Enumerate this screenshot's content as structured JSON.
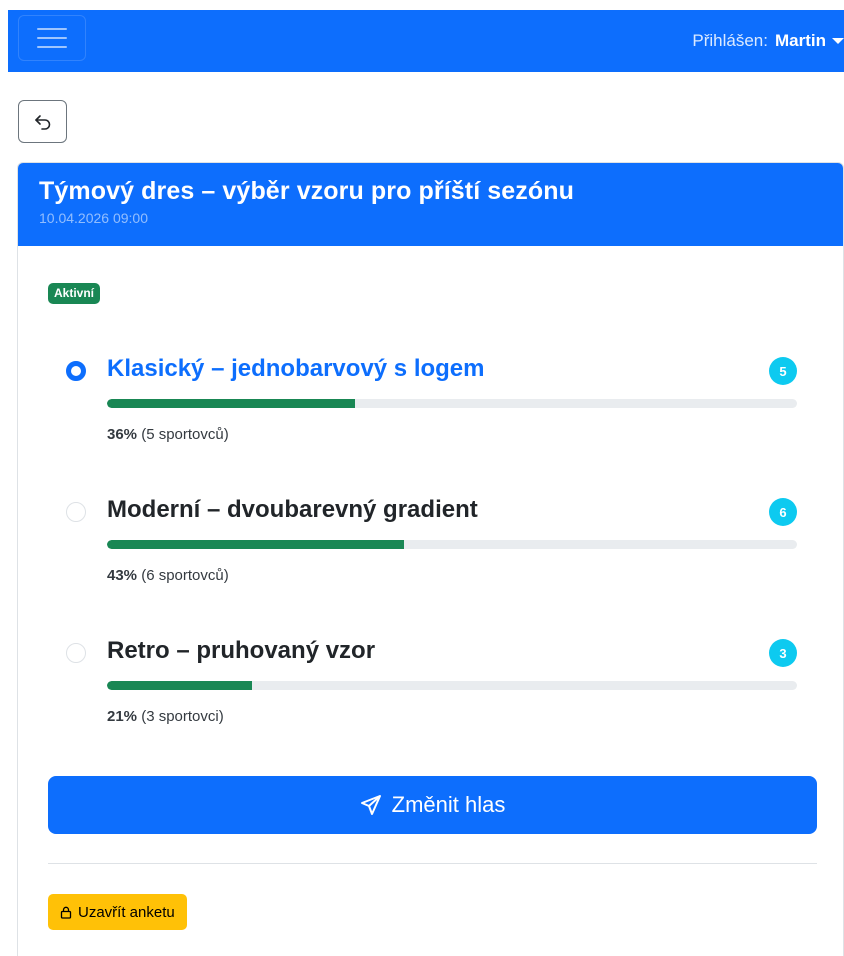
{
  "navbar": {
    "menu_icon": "hamburger-icon",
    "user_prefix": "Přihlášen:",
    "user_name": "Martin",
    "dropdown_icon": "caret-down-icon",
    "bg_color": "#0d6efd"
  },
  "back_button": {
    "icon": "undo-arrow-icon"
  },
  "poll": {
    "title": "Týmový dres – výběr vzoru pro příští sezónu",
    "date": "10.04.2026 09:00",
    "status": "Aktivní",
    "options": [
      {
        "label": "Klasický – jednobarvový s logem",
        "count": "5",
        "percent": "36%",
        "voters": "(5 sportovců)",
        "fraction": 0.36,
        "selected": true
      },
      {
        "label": "Moderní – dvoubarevný gradient",
        "count": "6",
        "percent": "43%",
        "voters": "(6 sportovců)",
        "fraction": 0.43,
        "selected": false
      },
      {
        "label": "Retro – pruhovaný vzor",
        "count": "3",
        "percent": "21%",
        "voters": "(3 sportovci)",
        "fraction": 0.21,
        "selected": false
      }
    ],
    "submit_label": "Změnit hlas",
    "submit_icon": "paper-plane-icon",
    "close_label": "Uzavřít anketu",
    "close_icon": "lock-icon"
  },
  "colors": {
    "primary": "#0d6efd",
    "success": "#198754",
    "info": "#0dcaf0",
    "warning": "#ffc107"
  }
}
